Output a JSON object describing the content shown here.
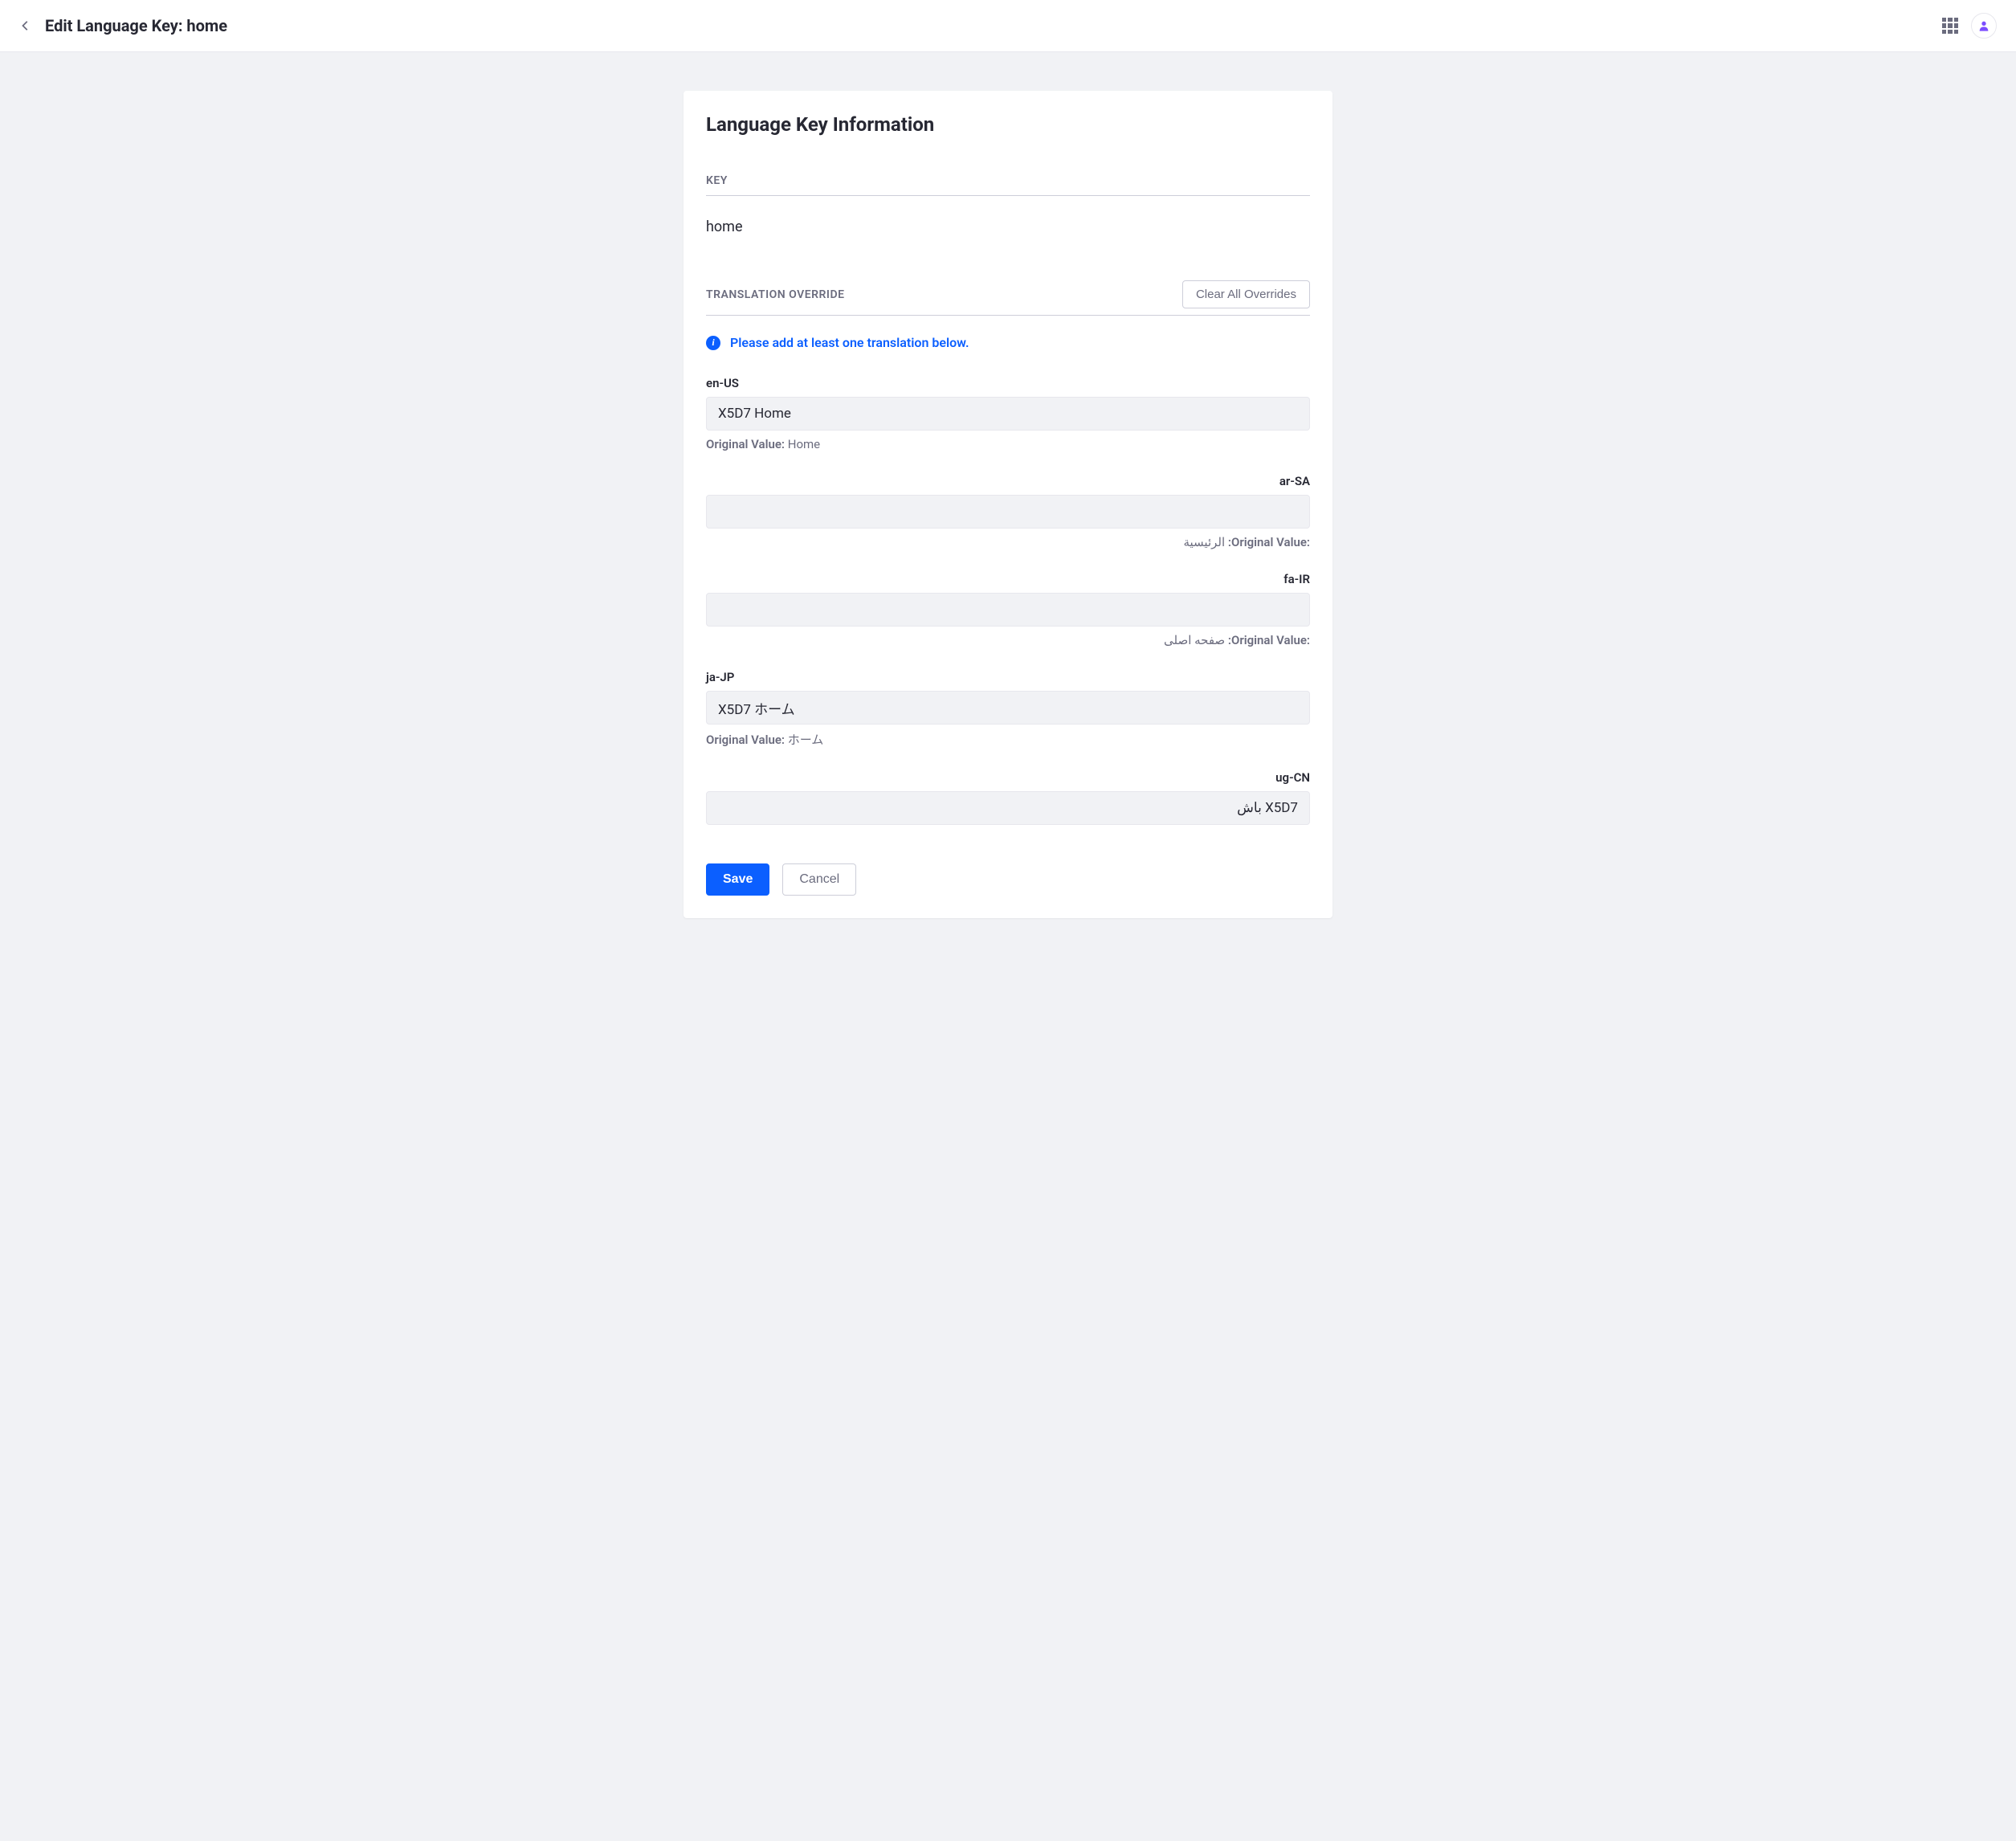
{
  "header": {
    "title": "Edit Language Key: home"
  },
  "card": {
    "title": "Language Key Information",
    "key_section_label": "KEY",
    "key_value": "home",
    "override_section_label": "TRANSLATION OVERRIDE",
    "clear_all_button": "Clear All Overrides",
    "alert_message": "Please add at least one translation below.",
    "original_value_label": "Original Value:"
  },
  "translations": {
    "en_us": {
      "label": "en-US",
      "value": "X5D7 Home",
      "original": "Home"
    },
    "ar_sa": {
      "label": "ar-SA",
      "value": "",
      "original": "الرئيسية"
    },
    "fa_ir": {
      "label": "fa-IR",
      "value": "",
      "original": "صفحه اصلی"
    },
    "ja_jp": {
      "label": "ja-JP",
      "value": "X5D7 ホーム",
      "original": "ホーム"
    },
    "ug_cn": {
      "label": "ug-CN",
      "value": "X5D7 باش",
      "original": ""
    }
  },
  "actions": {
    "save": "Save",
    "cancel": "Cancel"
  }
}
